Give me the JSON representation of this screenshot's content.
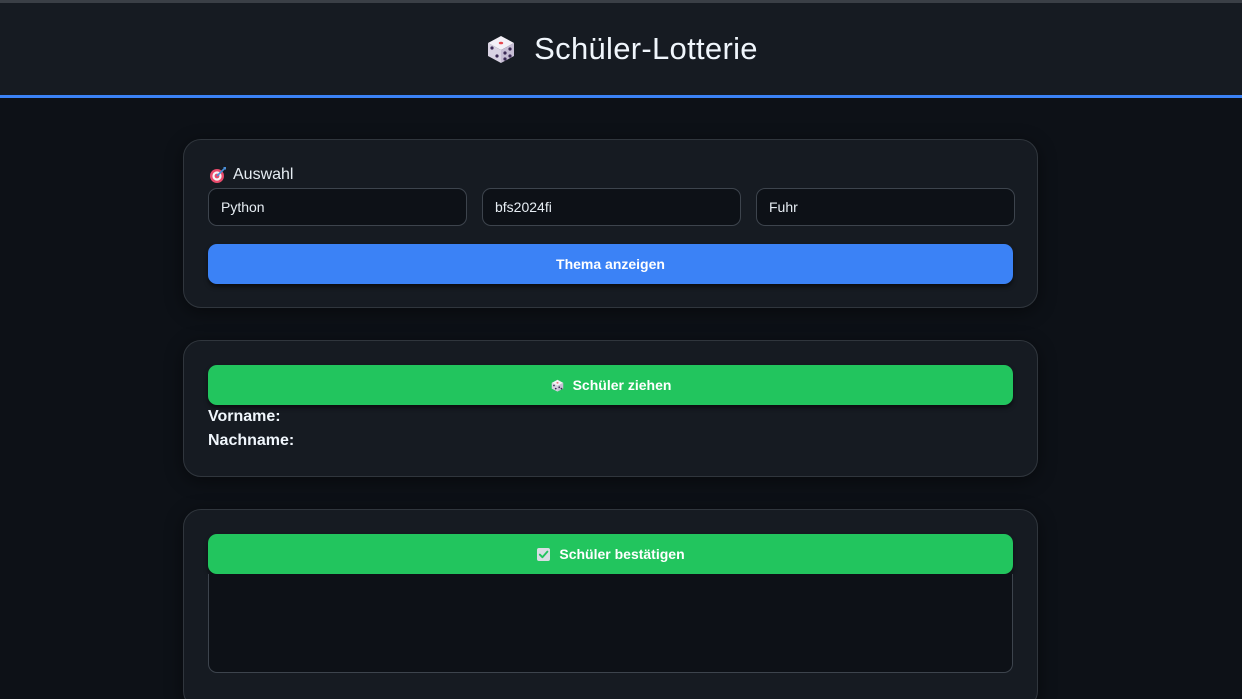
{
  "header": {
    "title": "Schüler-Lotterie",
    "icon": "dice-icon"
  },
  "selection": {
    "label": "Auswahl",
    "icon": "target-icon",
    "subject": "Python",
    "class": "bfs2024fi",
    "teacher": "Fuhr",
    "show_topic_label": "Thema anzeigen"
  },
  "draw": {
    "button_label": "Schüler ziehen",
    "icon": "dice-icon",
    "firstname_label": "Vorname:",
    "lastname_label": "Nachname:"
  },
  "confirm": {
    "button_label": "Schüler bestätigen",
    "icon": "check-box-icon",
    "output_text": ""
  },
  "colors": {
    "background": "#0d1117",
    "card": "#161b22",
    "accent_blue": "#3b82f6",
    "accent_green": "#22c55e"
  }
}
